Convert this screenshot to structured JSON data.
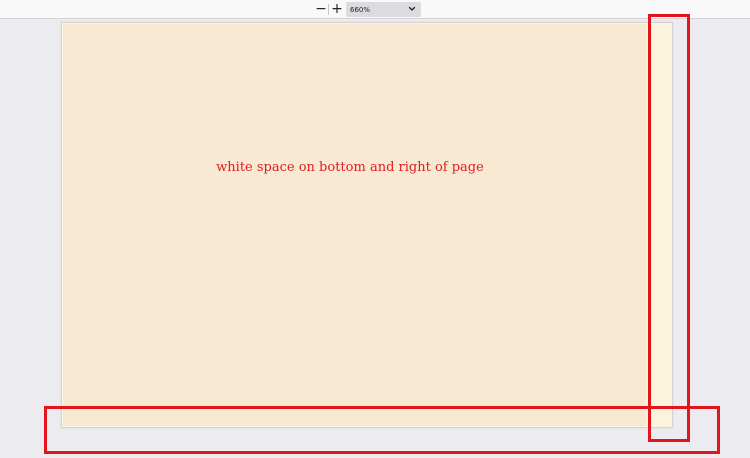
{
  "toolbar": {
    "zoom_out_icon": "−",
    "zoom_in_icon": "+",
    "zoom_level": "660%"
  },
  "page": {
    "text": "white space on bottom and right of page"
  },
  "colors": {
    "page_content": "#f8ead2",
    "page_margin": "#fbf3dc",
    "viewer_background": "#ecebef",
    "text": "#e01b24",
    "highlight_box": "#e3141c"
  },
  "icons": [
    "minus-icon",
    "plus-icon",
    "chevron-down-icon"
  ]
}
